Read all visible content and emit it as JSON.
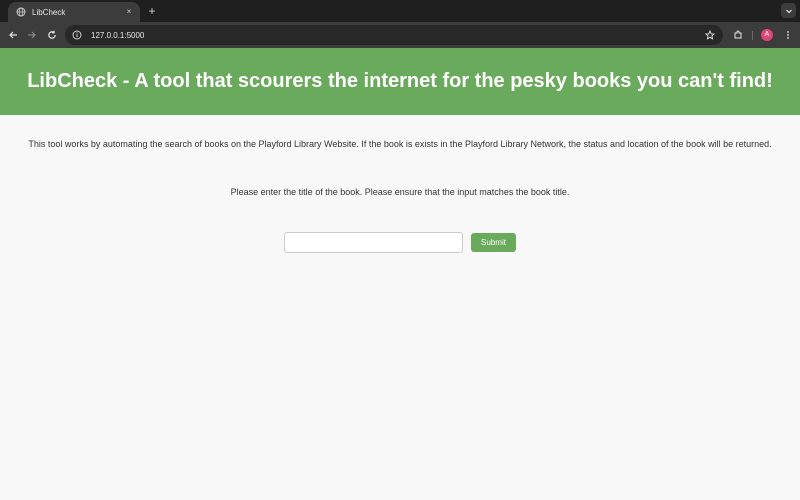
{
  "browser": {
    "tab": {
      "title": "LibCheck",
      "close_glyph": "×"
    },
    "new_tab_glyph": "+",
    "url": "127.0.0.1:5000",
    "profile_initial": "A",
    "icons": [
      "globe-icon",
      "close-icon",
      "plus-icon",
      "chevron-down-icon",
      "back-arrow-icon",
      "forward-arrow-icon",
      "reload-icon",
      "site-info-icon",
      "star-icon",
      "extensions-icon",
      "kebab-menu-icon"
    ]
  },
  "page": {
    "header_title": "LibCheck - A tool that scourers the internet for the pesky books you can't find!",
    "description": "This tool works by automating the search of books on the Playford Library Website. If the book is exists in the Playford Library Network, the status and location of the book will be returned.",
    "instruction": "Please enter the title of the book. Please ensure that the input matches the book title.",
    "input_value": "",
    "submit_label": "Submit"
  },
  "colors": {
    "accent_green": "#6aaa5c",
    "page_background": "#f8f8f8",
    "browser_dark": "#1f1f1f",
    "avatar_pink": "#e0457b"
  }
}
